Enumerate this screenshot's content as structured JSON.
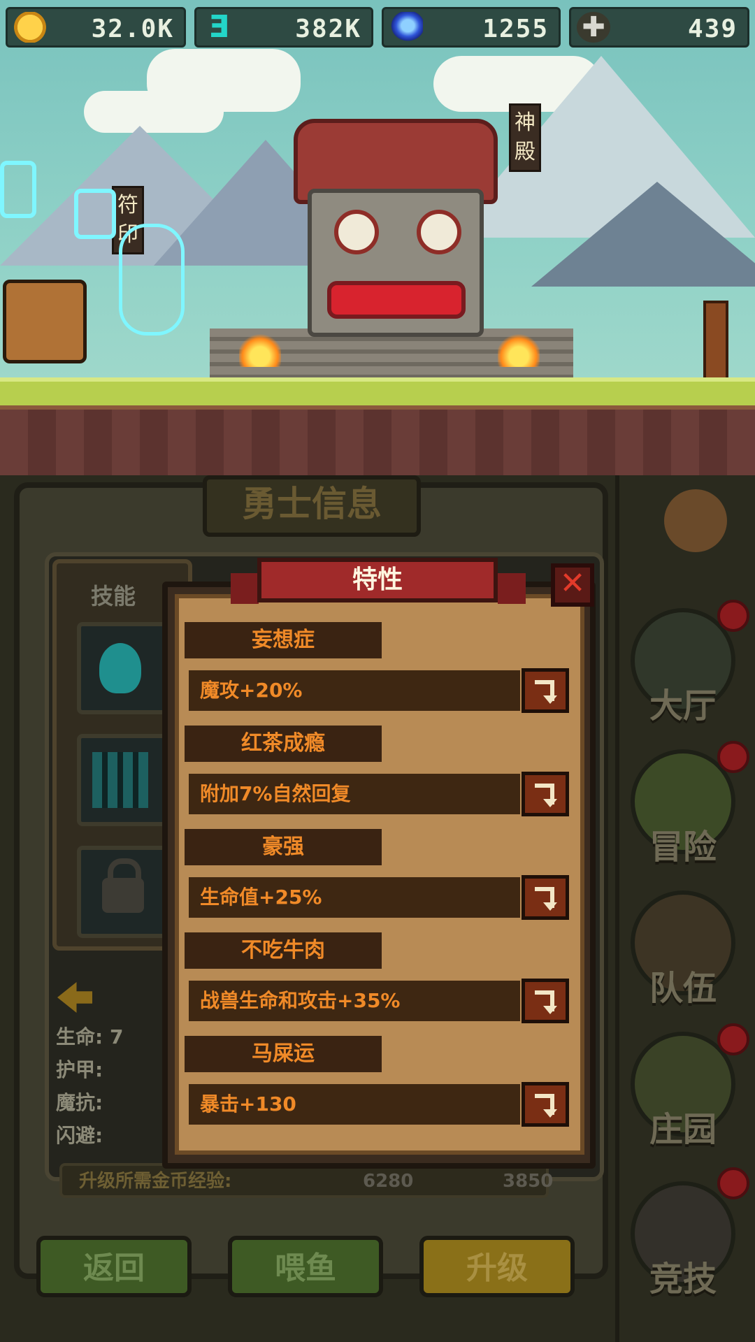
{
  "hud": {
    "gold": {
      "icon": "gold-coin-icon",
      "value": "32.0K"
    },
    "energy": {
      "icon": "energy-e-icon",
      "value": "382K"
    },
    "gem": {
      "icon": "blue-gem-icon",
      "value": "1255"
    },
    "cross": {
      "icon": "holy-cross-icon",
      "value": "439"
    }
  },
  "scene": {
    "banner_left": "符印",
    "banner_right": "神殿"
  },
  "panel": {
    "title": "勇士信息",
    "skills_label": "技能",
    "stats": [
      "生命:",
      "护甲:",
      "魔抗:",
      "闪避:"
    ],
    "stat_life_value": "7",
    "cost_label": "升级所需金币经验:",
    "cost_gold": "6280",
    "cost_exp": "3850"
  },
  "buttons": {
    "back": "返回",
    "feed": "喂鱼",
    "upgrade": "升级"
  },
  "sidebar": {
    "items": [
      {
        "label": "大厅",
        "icon": "hall-icon"
      },
      {
        "label": "冒险",
        "icon": "adventure-icon"
      },
      {
        "label": "队伍",
        "icon": "team-icon"
      },
      {
        "label": "庄园",
        "icon": "manor-icon"
      },
      {
        "label": "竞技",
        "icon": "arena-swords-icon"
      }
    ]
  },
  "dialog": {
    "title": "特性",
    "traits": [
      {
        "name": "妄想症",
        "effect": "魔攻+20%"
      },
      {
        "name": "红茶成瘾",
        "effect": "附加7%自然回复"
      },
      {
        "name": "豪强",
        "effect": "生命值+25%"
      },
      {
        "name": "不吃牛肉",
        "effect": "战兽生命和攻击+35%"
      },
      {
        "name": "马屎运",
        "effect": "暴击+130"
      }
    ]
  },
  "colors": {
    "trait_text": "#f08a28",
    "ribbon": "#a02a2a",
    "parchment": "#b88b55",
    "notification": "#8a1a1d"
  }
}
